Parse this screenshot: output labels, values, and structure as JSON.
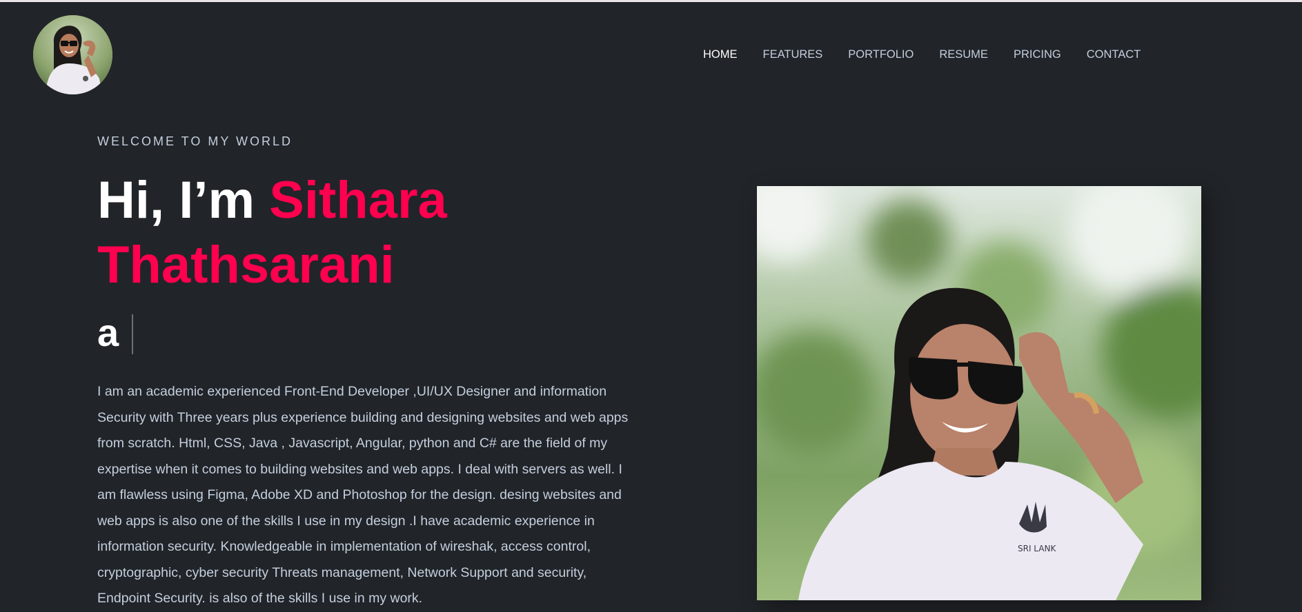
{
  "header": {
    "nav": [
      {
        "label": "HOME",
        "active": true
      },
      {
        "label": "FEATURES",
        "active": false
      },
      {
        "label": "PORTFOLIO",
        "active": false
      },
      {
        "label": "RESUME",
        "active": false
      },
      {
        "label": "PRICING",
        "active": false
      },
      {
        "label": "CONTACT",
        "active": false
      }
    ]
  },
  "hero": {
    "welcome": "WELCOME TO MY WORLD",
    "greeting": "Hi, I’m",
    "name": "Sithara Thathsarani",
    "typed_text": "a",
    "bio": "I am an academic experienced Front-End Developer ,UI/UX Designer and information Security with Three years plus experience building and designing websites and web apps from scratch. Html, CSS, Java , Javascript, Angular, python and C# are the field of my expertise when it comes to building websites and web apps. I deal with servers as well. I am flawless using Figma, Adobe XD and Photoshop for the design. desing websites and web apps is also one of the skills I use in my design .I have academic experience in information security. Knowledgeable in implementation of wireshak, access control, cryptographic, cyber security Threats management, Network Support and security, Endpoint Security. is also of the skills I use in my work."
  },
  "colors": {
    "background": "#212428",
    "accent": "#ff014f",
    "text": "#c4cfde",
    "heading": "#ffffff"
  }
}
